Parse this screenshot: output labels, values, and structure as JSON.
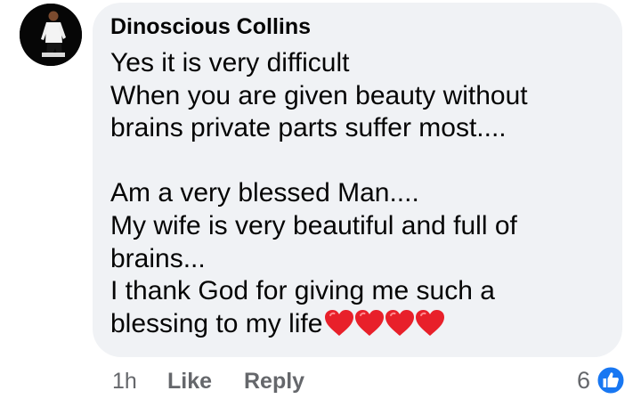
{
  "comment": {
    "author": "Dinoscious Collins",
    "lines": [
      "Yes it is very difficult",
      "When you are given beauty without",
      "brains private parts suffer most....",
      "",
      "Am a very blessed Man....",
      "My wife is very beautiful and full of",
      "brains...",
      "I thank God for giving me such a",
      "blessing to my life"
    ],
    "emoji": "heart-icon x4",
    "time": "1h",
    "like_label": "Like",
    "reply_label": "Reply",
    "reaction_count": "6"
  },
  "colors": {
    "bubble": "#f0f2f5",
    "text": "#050505",
    "secondary": "#65676b",
    "like_blue": "#1877f2",
    "heart_red": "#e8202a"
  }
}
